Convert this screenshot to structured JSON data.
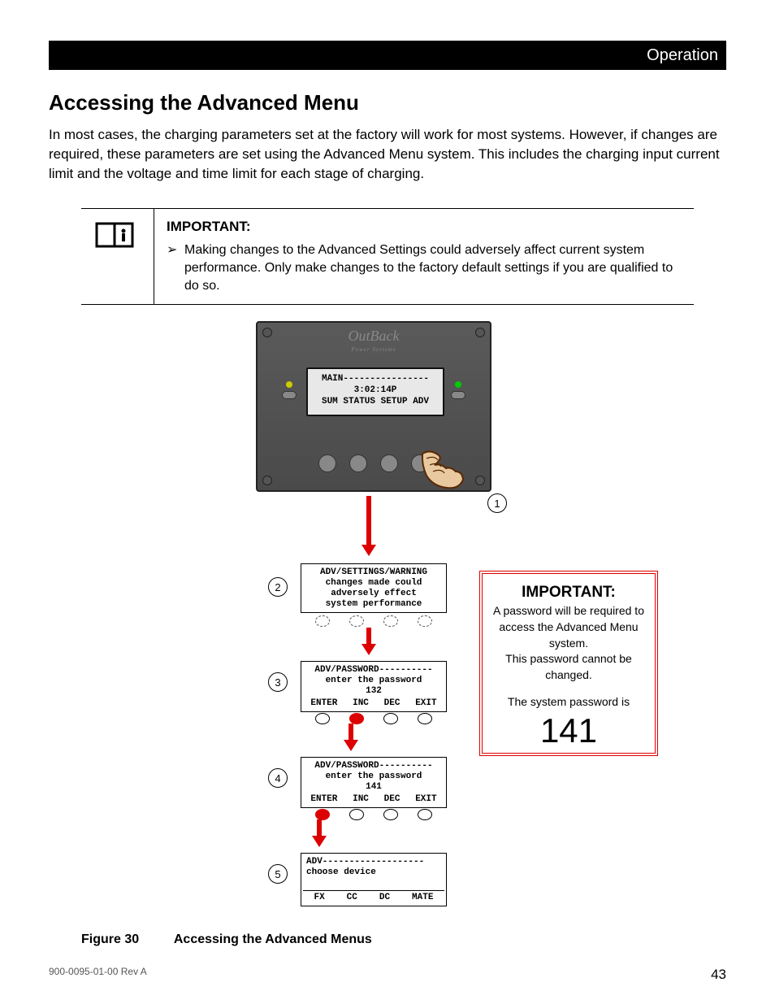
{
  "header": {
    "section": "Operation"
  },
  "title": "Accessing the Advanced Menu",
  "intro": "In most cases, the charging parameters set at the factory will work for most systems.  However, if changes are required, these parameters  are set using the Advanced Menu system.  This includes the charging input current limit and the voltage and time limit for each stage of charging.",
  "important": {
    "heading": "IMPORTANT:",
    "body": "Making changes to the Advanced Settings could adversely affect current system performance.  Only make changes to the factory default settings if you are qualified to do so."
  },
  "device": {
    "logo": "OutBack",
    "logo_sub": "Power Systems",
    "lcd": {
      "line1": "MAIN----------------",
      "line2": "3:02:14P",
      "line3": "",
      "line4": "SUM  STATUS  SETUP  ADV"
    }
  },
  "steps": {
    "n1": "1",
    "n2": "2",
    "n3": "3",
    "n4": "4",
    "n5": "5"
  },
  "screen2": {
    "l1": "ADV/SETTINGS/WARNING",
    "l2": "changes made could",
    "l3": "adversely effect",
    "l4": "system performance"
  },
  "screen3": {
    "l1": "ADV/PASSWORD----------",
    "l2": "enter the password",
    "l3": "132",
    "b1": "ENTER",
    "b2": "INC",
    "b3": "DEC",
    "b4": "EXIT"
  },
  "screen4": {
    "l1": "ADV/PASSWORD----------",
    "l2": "enter the password",
    "l3": "141",
    "b1": "ENTER",
    "b2": "INC",
    "b3": "DEC",
    "b4": "EXIT"
  },
  "screen5": {
    "l1": "ADV-------------------",
    "l2": "choose device",
    "b1": "FX",
    "b2": "CC",
    "b3": "DC",
    "b4": "MATE"
  },
  "pwdcallout": {
    "heading": "IMPORTANT:",
    "line1": "A password will be required to access the Advanced Menu system.",
    "line2": "This password cannot be changed.",
    "line3": "The system password is",
    "password": "141"
  },
  "figure": {
    "num": "Figure 30",
    "title": "Accessing the Advanced Menus"
  },
  "footer": {
    "doc": "900-0095-01-00 Rev A",
    "page": "43"
  }
}
